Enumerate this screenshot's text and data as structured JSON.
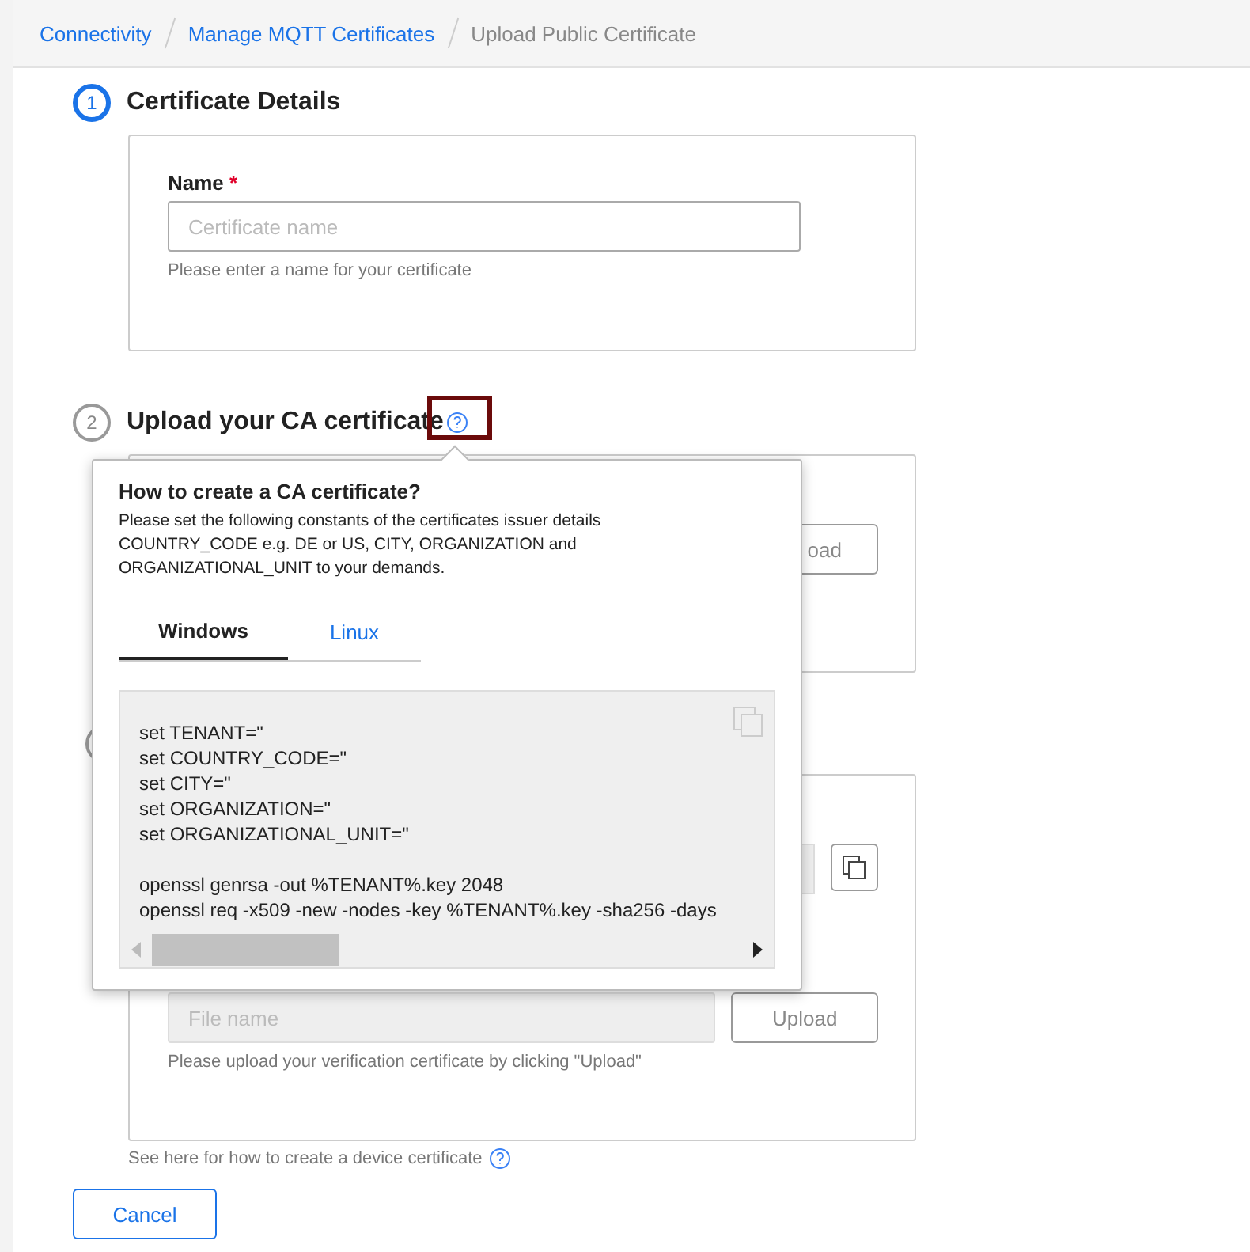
{
  "breadcrumb": [
    {
      "label": "Connectivity",
      "current": false
    },
    {
      "label": "Manage MQTT Certificates",
      "current": false
    },
    {
      "label": "Upload Public Certificate",
      "current": true
    }
  ],
  "step1": {
    "number": "1",
    "active": true,
    "title": "Certificate Details",
    "field_label": "Name",
    "required_mark": "*",
    "placeholder": "Certificate name",
    "hint": "Please enter a name for your certificate"
  },
  "step2": {
    "number": "2",
    "active": false,
    "title": "Upload your CA certificate",
    "button_partial": "oad"
  },
  "step3": {
    "active": false,
    "placeholder": "File name",
    "button": "Upload",
    "hint": "Please upload your verification certificate by clicking \"Upload\""
  },
  "device_help": "See here for how to create a device certificate",
  "cancel": "Cancel",
  "popover": {
    "title": "How to create a CA certificate?",
    "text": "Please set the following constants of the certificates issuer details COUNTRY_CODE e.g. DE or US, CITY, ORGANIZATION and ORGANIZATIONAL_UNIT to your demands.",
    "tabs": [
      {
        "label": "Windows",
        "selected": true
      },
      {
        "label": "Linux",
        "selected": false
      }
    ],
    "code": [
      [
        "set TENANT=\"",
        "set COUNTRY_CODE=\"",
        "set CITY=\"",
        "set ORGANIZATION=\"",
        "set ORGANIZATIONAL_UNIT=\""
      ],
      [
        "openssl genrsa -out %TENANT%.key 2048",
        "openssl req -x509 -new -nodes -key %TENANT%.key -sha256 -days"
      ]
    ]
  }
}
